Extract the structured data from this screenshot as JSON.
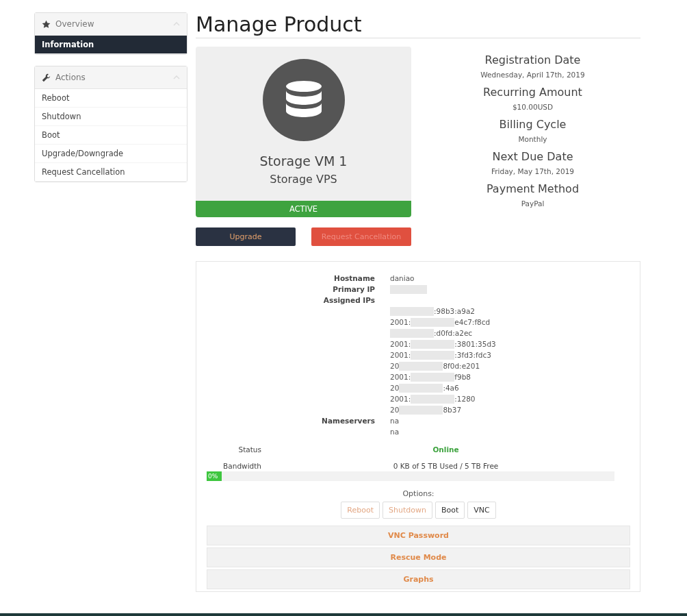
{
  "sidebar": {
    "panels": [
      {
        "title": "Overview",
        "kind": "star",
        "items": [
          {
            "label": "Information",
            "selected": true
          }
        ]
      },
      {
        "title": "Actions",
        "kind": "wrench",
        "items": [
          {
            "label": "Reboot",
            "selected": false
          },
          {
            "label": "Shutdown",
            "selected": false
          },
          {
            "label": "Boot",
            "selected": false
          },
          {
            "label": "Upgrade/Downgrade",
            "selected": false
          },
          {
            "label": "Request Cancellation",
            "selected": false
          }
        ]
      }
    ]
  },
  "page_title": "Manage Product",
  "product": {
    "name": "Storage VM 1",
    "group": "Storage VPS",
    "status": "ACTIVE"
  },
  "product_buttons": [
    {
      "label": "Upgrade",
      "kind": "primary"
    },
    {
      "label": "Request Cancellation",
      "kind": "danger"
    }
  ],
  "details": [
    {
      "label": "Registration Date",
      "value": "Wednesday, April 17th, 2019"
    },
    {
      "label": "Recurring Amount",
      "value": "$10.00USD"
    },
    {
      "label": "Billing Cycle",
      "value": "Monthly"
    },
    {
      "label": "Next Due Date",
      "value": "Friday, May 17th, 2019"
    },
    {
      "label": "Payment Method",
      "value": "PayPal"
    }
  ],
  "server": {
    "hostname_label": "Hostname",
    "hostname": "daniao",
    "primary_ip_label": "Primary IP",
    "assigned_ips_label": "Assigned IPs",
    "assigned_ips": [
      {
        "tail": ":98b3:a9a2"
      },
      {
        "head": "2001:",
        "tail": "e4c7:f8cd"
      },
      {
        "tail": ":d0fd:a2ec"
      },
      {
        "head": "2001:",
        "tail": ":3801:35d3"
      },
      {
        "head": "2001:",
        "tail": ":3fd3:fdc3"
      },
      {
        "head": "20",
        "tail": "8f0d:e201"
      },
      {
        "head": "2001:",
        "tail": "f9b8"
      },
      {
        "head": "20",
        "tail": ":4a6"
      },
      {
        "head": "2001:",
        "tail": ":1280"
      },
      {
        "head": "20",
        "tail": "8b37"
      }
    ],
    "nameservers_label": "Nameservers",
    "nameservers": [
      "na",
      "na"
    ],
    "status_label": "Status",
    "status": "Online",
    "bandwidth_label": "Bandwidth",
    "bandwidth": "0 KB of 5 TB Used / 5 TB Free",
    "bandwidth_bar": {
      "level": 0,
      "reading": "0%"
    },
    "options_label": "Options:",
    "options": [
      {
        "label": "Reboot",
        "disabled": true
      },
      {
        "label": "Shutdown",
        "disabled": true
      },
      {
        "label": "Boot",
        "disabled": false
      },
      {
        "label": "VNC",
        "disabled": false
      }
    ],
    "sections": [
      "VNC Password",
      "Rescue Mode",
      "Graphs"
    ]
  }
}
